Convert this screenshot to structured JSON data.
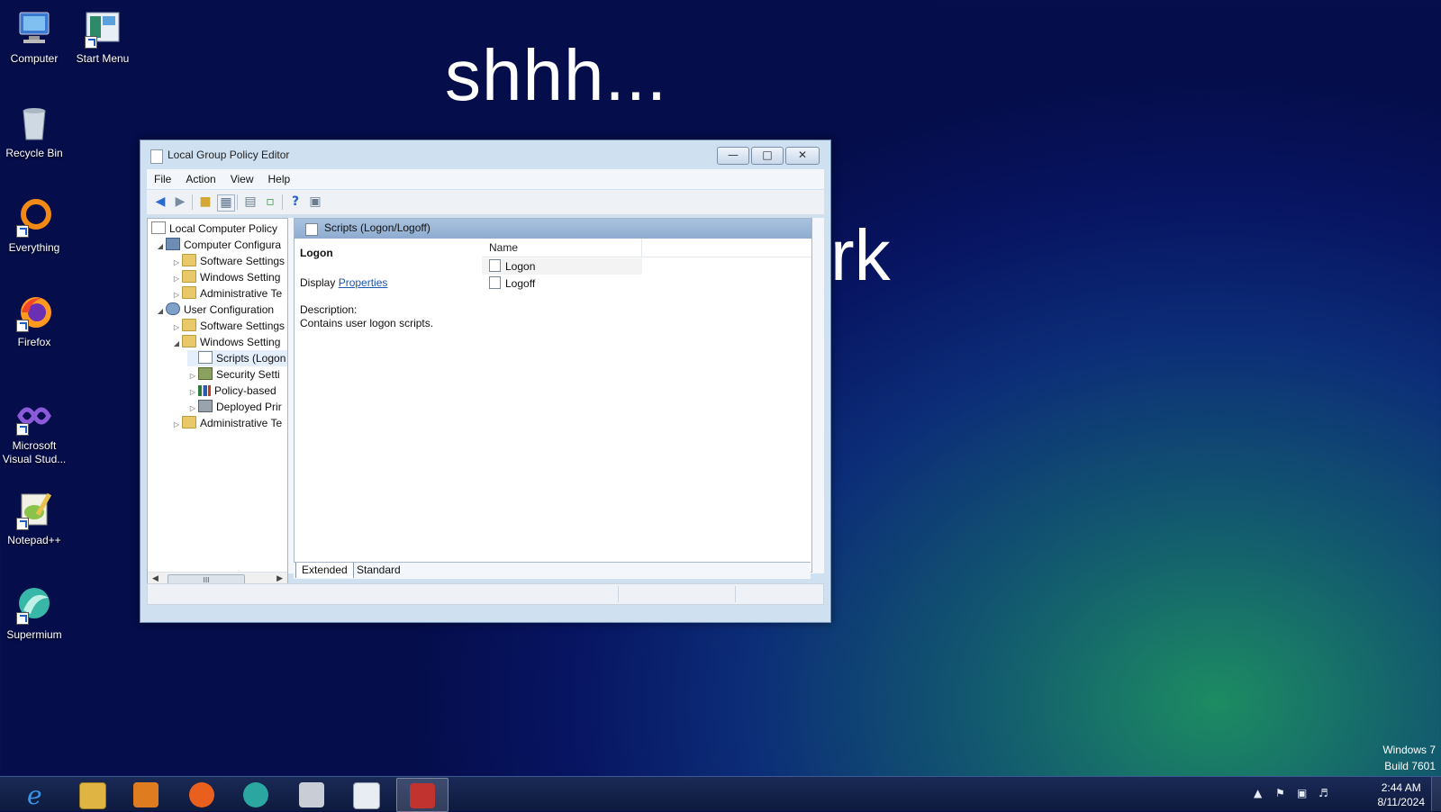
{
  "wallpaper": {
    "headline": "shhh...",
    "fragment": "rk",
    "os_name": "Windows 7",
    "build": "Build 7601"
  },
  "desktop_icons": [
    {
      "label": "Computer",
      "icon": "computer-icon"
    },
    {
      "label": "Start Menu",
      "icon": "start-menu-icon"
    },
    {
      "label": "Recycle Bin",
      "icon": "recycle-bin-icon"
    },
    {
      "label": "Everything",
      "icon": "everything-icon"
    },
    {
      "label": "Firefox",
      "icon": "firefox-icon"
    },
    {
      "label": "Microsoft Visual Stud...",
      "icon": "visual-studio-icon"
    },
    {
      "label": "Notepad++",
      "icon": "notepad-plus-plus-icon"
    },
    {
      "label": "Supermium",
      "icon": "supermium-icon"
    }
  ],
  "window": {
    "title": "Local Group Policy Editor",
    "menu": [
      "File",
      "Action",
      "View",
      "Help"
    ],
    "tree": [
      {
        "label": "Local Computer Policy"
      },
      {
        "label": "Computer Configura"
      },
      {
        "label": "Software Settings"
      },
      {
        "label": "Windows Setting"
      },
      {
        "label": "Administrative Te"
      },
      {
        "label": "User Configuration"
      },
      {
        "label": "Software Settings"
      },
      {
        "label": "Windows Setting"
      },
      {
        "label": "Scripts (Logon"
      },
      {
        "label": "Security Setti"
      },
      {
        "label": "Policy-based"
      },
      {
        "label": "Deployed Prir"
      },
      {
        "label": "Administrative Te"
      }
    ],
    "pane_header": "Scripts (Logon/Logoff)",
    "extended": {
      "title": "Logon",
      "display_prefix": "Display",
      "display_link": "Properties",
      "description_label": "Description:",
      "description": "Contains user logon scripts."
    },
    "list": {
      "column_name": "Name",
      "items": [
        "Logon",
        "Logoff"
      ]
    },
    "tabs": [
      "Extended",
      "Standard"
    ],
    "scroll_thumb_label": "III"
  },
  "taskbar": {
    "apps": [
      {
        "icon": "internet-explorer-icon",
        "color": "#1f7fd6"
      },
      {
        "icon": "file-explorer-icon",
        "color": "#e0b443"
      },
      {
        "icon": "media-player-icon",
        "color": "#e07c20"
      },
      {
        "icon": "firefox-icon",
        "color": "#e9601e"
      },
      {
        "icon": "supermium-icon",
        "color": "#2ba6a0"
      },
      {
        "icon": "snipping-tool-icon",
        "color": "#c94a4a"
      },
      {
        "icon": "notepad-icon",
        "color": "#cfd8e4"
      },
      {
        "icon": "toolbox-icon",
        "color": "#c0332e",
        "active": true
      }
    ],
    "clock_time": "2:44 AM",
    "clock_date": "8/11/2024"
  }
}
